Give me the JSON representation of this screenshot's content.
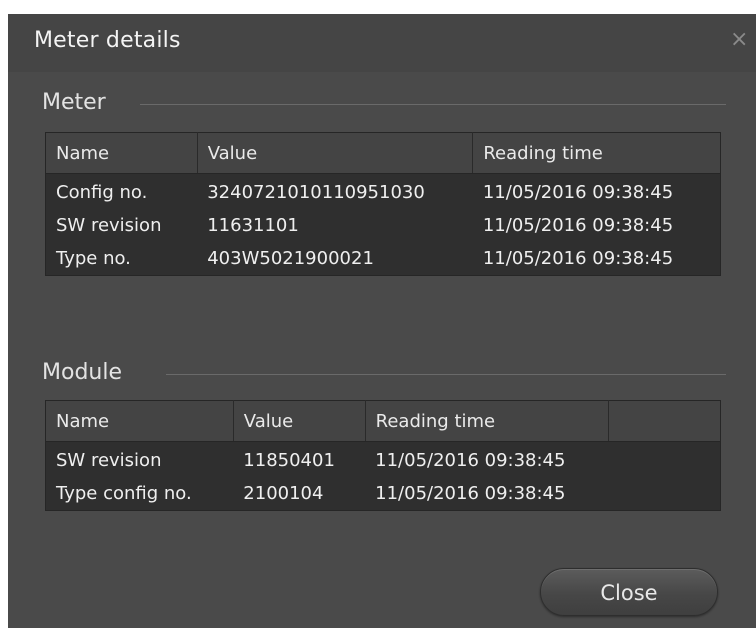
{
  "dialog": {
    "title": "Meter details",
    "close_icon_glyph": "×",
    "close_button_label": "Close"
  },
  "meter": {
    "section_label": "Meter",
    "columns": [
      "Name",
      "Value",
      "Reading time"
    ],
    "rows": [
      [
        "Config no.",
        "3240721010110951030",
        "11/05/2016 09:38:45"
      ],
      [
        "SW revision",
        "11631101",
        "11/05/2016 09:38:45"
      ],
      [
        "Type no.",
        "403W5021900021",
        "11/05/2016 09:38:45"
      ]
    ]
  },
  "module": {
    "section_label": "Module",
    "columns": [
      "Name",
      "Value",
      "Reading time",
      ""
    ],
    "rows": [
      [
        "SW revision",
        "11850401",
        "11/05/2016 09:38:45"
      ],
      [
        "Type config no.",
        "2100104",
        "11/05/2016 09:38:45"
      ]
    ]
  },
  "colors": {
    "dialog_background": "#4a4a4a",
    "grid_background": "#2f2f2f",
    "header_background": "#444444",
    "text": "#efefef"
  }
}
